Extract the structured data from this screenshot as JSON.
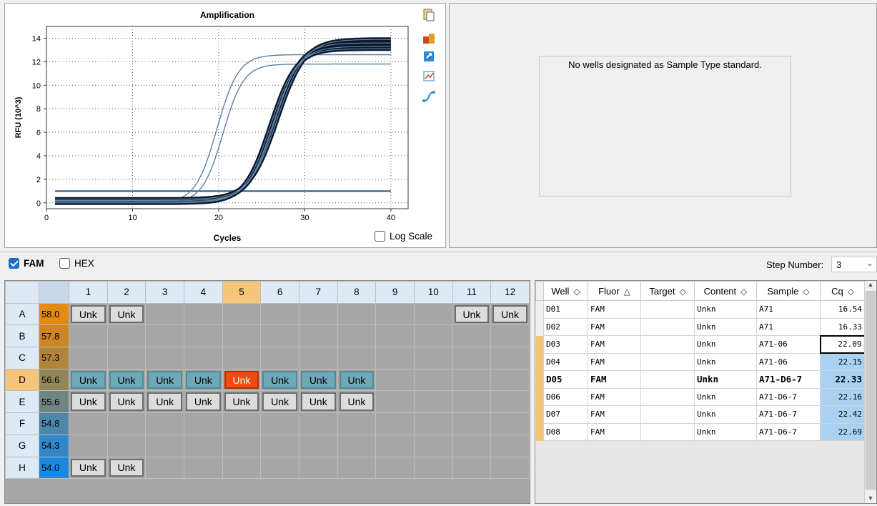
{
  "chart_data": {
    "type": "line",
    "title": "Amplification",
    "xlabel": "Cycles",
    "ylabel": "RFU (10^3)",
    "xlim": [
      0,
      42
    ],
    "ylim": [
      -0.5,
      15
    ],
    "xticks": [
      0,
      10,
      20,
      30,
      40
    ],
    "yticks": [
      0,
      2,
      4,
      6,
      8,
      10,
      12,
      14
    ],
    "threshold": 1.0,
    "grid": "dotted",
    "series": [
      {
        "values_fn": "sigmoid",
        "midpoint": 19.8,
        "slope": 1.25,
        "plateau": 12.6,
        "base": 0.0,
        "highlight": false
      },
      {
        "values_fn": "sigmoid",
        "midpoint": 20.5,
        "slope": 1.2,
        "plateau": 11.8,
        "base": 0.0,
        "highlight": false
      },
      {
        "values_fn": "sigmoid",
        "midpoint": 26.0,
        "slope": 1.5,
        "plateau": 13.1,
        "base": 0.0,
        "highlight": true
      },
      {
        "values_fn": "sigmoid",
        "midpoint": 26.3,
        "slope": 1.5,
        "plateau": 13.3,
        "base": 0.1,
        "highlight": true
      },
      {
        "values_fn": "sigmoid",
        "midpoint": 26.5,
        "slope": 1.5,
        "plateau": 13.6,
        "base": 0.2,
        "highlight": true
      },
      {
        "values_fn": "sigmoid",
        "midpoint": 26.8,
        "slope": 1.6,
        "plateau": 13.9,
        "base": 0.3,
        "highlight": true
      }
    ],
    "x_range": [
      1,
      40
    ]
  },
  "log_scale_label": "Log Scale",
  "std_message": "No wells designated as Sample Type standard.",
  "fluors": [
    {
      "label": "FAM",
      "checked": true
    },
    {
      "label": "HEX",
      "checked": false
    }
  ],
  "step_label": "Step Number:",
  "step_value": "3",
  "plate": {
    "columns": [
      "1",
      "2",
      "3",
      "4",
      "5",
      "6",
      "7",
      "8",
      "9",
      "10",
      "11",
      "12"
    ],
    "selected_column": "5",
    "rows": [
      {
        "label": "A",
        "temp": "58.0",
        "temp_color": "#e38a14",
        "wells": [
          "Unk",
          "Unk",
          "",
          "",
          "",
          "",
          "",
          "",
          "",
          "",
          "Unk",
          "Unk"
        ],
        "states": [
          "n",
          "n",
          "",
          "",
          "",
          "",
          "",
          "",
          "",
          "",
          "n",
          "n"
        ]
      },
      {
        "label": "B",
        "temp": "57.8",
        "temp_color": "#cd8525",
        "wells": [
          "",
          "",
          "",
          "",
          "",
          "",
          "",
          "",
          "",
          "",
          "",
          ""
        ],
        "states": [
          "",
          "",
          "",
          "",
          "",
          "",
          "",
          "",
          "",
          "",
          "",
          ""
        ]
      },
      {
        "label": "C",
        "temp": "57.3",
        "temp_color": "#b3853c",
        "wells": [
          "",
          "",
          "",
          "",
          "",
          "",
          "",
          "",
          "",
          "",
          "",
          ""
        ],
        "states": [
          "",
          "",
          "",
          "",
          "",
          "",
          "",
          "",
          "",
          "",
          "",
          ""
        ]
      },
      {
        "label": "D",
        "temp": "56.6",
        "temp_color": "#93855a",
        "wells": [
          "Unk",
          "Unk",
          "Unk",
          "Unk",
          "Unk",
          "Unk",
          "Unk",
          "Unk",
          "",
          "",
          "",
          ""
        ],
        "states": [
          "s",
          "s",
          "s",
          "s",
          "a",
          "s",
          "s",
          "s",
          "",
          "",
          "",
          ""
        ],
        "selected": true
      },
      {
        "label": "E",
        "temp": "55.6",
        "temp_color": "#6f8580",
        "wells": [
          "Unk",
          "Unk",
          "Unk",
          "Unk",
          "Unk",
          "Unk",
          "Unk",
          "Unk",
          "",
          "",
          "",
          ""
        ],
        "states": [
          "n",
          "n",
          "n",
          "n",
          "n",
          "n",
          "n",
          "n",
          "",
          "",
          "",
          ""
        ]
      },
      {
        "label": "F",
        "temp": "54.8",
        "temp_color": "#4e86a9",
        "wells": [
          "",
          "",
          "",
          "",
          "",
          "",
          "",
          "",
          "",
          "",
          "",
          ""
        ],
        "states": [
          "",
          "",
          "",
          "",
          "",
          "",
          "",
          "",
          "",
          "",
          "",
          ""
        ]
      },
      {
        "label": "G",
        "temp": "54.3",
        "temp_color": "#3087c9",
        "wells": [
          "",
          "",
          "",
          "",
          "",
          "",
          "",
          "",
          "",
          "",
          "",
          ""
        ],
        "states": [
          "",
          "",
          "",
          "",
          "",
          "",
          "",
          "",
          "",
          "",
          "",
          ""
        ]
      },
      {
        "label": "H",
        "temp": "54.0",
        "temp_color": "#1a88e0",
        "wells": [
          "Unk",
          "Unk",
          "",
          "",
          "",
          "",
          "",
          "",
          "",
          "",
          "",
          ""
        ],
        "states": [
          "n",
          "n",
          "",
          "",
          "",
          "",
          "",
          "",
          "",
          "",
          "",
          ""
        ]
      }
    ]
  },
  "table": {
    "headers": [
      "Well",
      "Fluor",
      "Target",
      "Content",
      "Sample",
      "Cq"
    ],
    "sort_icons": [
      "◇",
      "△",
      "◇",
      "◇",
      "◇",
      "◇"
    ],
    "rows": [
      {
        "well": "D01",
        "fluor": "FAM",
        "target": "",
        "content": "Unkn",
        "sample": "A71",
        "cq": "16.54",
        "state": ""
      },
      {
        "well": "D02",
        "fluor": "FAM",
        "target": "",
        "content": "Unkn",
        "sample": "A71",
        "cq": "16.33",
        "state": ""
      },
      {
        "well": "D03",
        "fluor": "FAM",
        "target": "",
        "content": "Unkn",
        "sample": "A71-06",
        "cq": "22.09",
        "state": "hl boxed"
      },
      {
        "well": "D04",
        "fluor": "FAM",
        "target": "",
        "content": "Unkn",
        "sample": "A71-06",
        "cq": "22.15",
        "state": "hl cq"
      },
      {
        "well": "D05",
        "fluor": "FAM",
        "target": "",
        "content": "Unkn",
        "sample": "A71-D6-7",
        "cq": "22.33",
        "state": "hl cq bold"
      },
      {
        "well": "D06",
        "fluor": "FAM",
        "target": "",
        "content": "Unkn",
        "sample": "A71-D6-7",
        "cq": "22.16",
        "state": "hl cq"
      },
      {
        "well": "D07",
        "fluor": "FAM",
        "target": "",
        "content": "Unkn",
        "sample": "A71-D6-7",
        "cq": "22.42",
        "state": "hl cq"
      },
      {
        "well": "D08",
        "fluor": "FAM",
        "target": "",
        "content": "Unkn",
        "sample": "A71-D6-7",
        "cq": "22.69",
        "state": "hl cq"
      }
    ]
  }
}
